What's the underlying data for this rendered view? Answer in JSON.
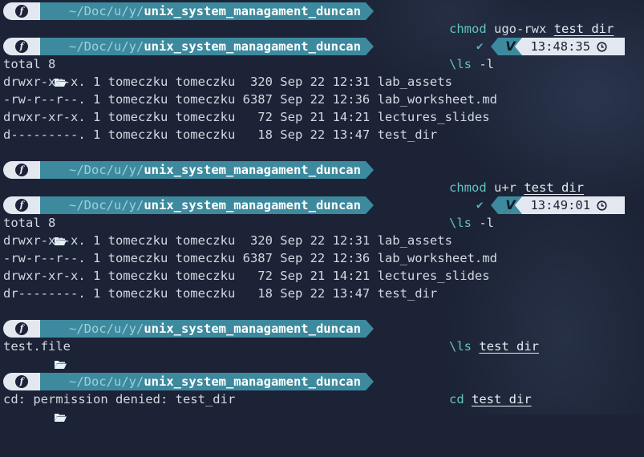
{
  "prompt": {
    "os_glyph": "f",
    "path_dim": "~/Doc/u/y/",
    "path_bold": "unix_system_managament_duncan"
  },
  "blocks": [
    {
      "cmd": "chmod",
      "args": " ugo-rwx ",
      "target": "test_dir"
    },
    {
      "cmd": "\\ls",
      "args": " -l",
      "target": "",
      "status_mark": "✔",
      "vi_mode": "V",
      "time": "13:48:35"
    },
    {
      "cmd": "chmod",
      "args": " u+r ",
      "target": "test_dir"
    },
    {
      "cmd": "\\ls",
      "args": " -l",
      "target": "",
      "status_mark": "✔",
      "vi_mode": "V",
      "time": "13:49:01"
    },
    {
      "cmd": "\\ls",
      "args": " ",
      "target": "test_dir"
    },
    {
      "cmd": "cd",
      "args": " ",
      "target": "test_dir"
    }
  ],
  "listing1": [
    "total 8",
    "drwxr-xr-x. 1 tomeczku tomeczku  320 Sep 22 12:31 lab_assets",
    "-rw-r--r--. 1 tomeczku tomeczku 6387 Sep 22 12:36 lab_worksheet.md",
    "drwxr-xr-x. 1 tomeczku tomeczku   72 Sep 21 14:21 lectures_slides",
    "d---------. 1 tomeczku tomeczku   18 Sep 22 13:47 test_dir"
  ],
  "listing2": [
    "total 8",
    "drwxr-xr-x. 1 tomeczku tomeczku  320 Sep 22 12:31 lab_assets",
    "-rw-r--r--. 1 tomeczku tomeczku 6387 Sep 22 12:36 lab_worksheet.md",
    "drwxr-xr-x. 1 tomeczku tomeczku   72 Sep 21 14:21 lectures_slides",
    "dr--------. 1 tomeczku tomeczku   18 Sep 22 13:47 test_dir"
  ],
  "ls_output": "test.file",
  "cd_output": "cd: permission denied: test_dir",
  "colors": {
    "background": "#1c2336",
    "path_segment": "#3d8a9e",
    "os_segment": "#e3e8f0",
    "command": "#62c3c3"
  },
  "icons": {
    "os": "fedora-icon",
    "folder": "folder-open-icon",
    "status": "check-icon",
    "clock": "clock-icon"
  }
}
